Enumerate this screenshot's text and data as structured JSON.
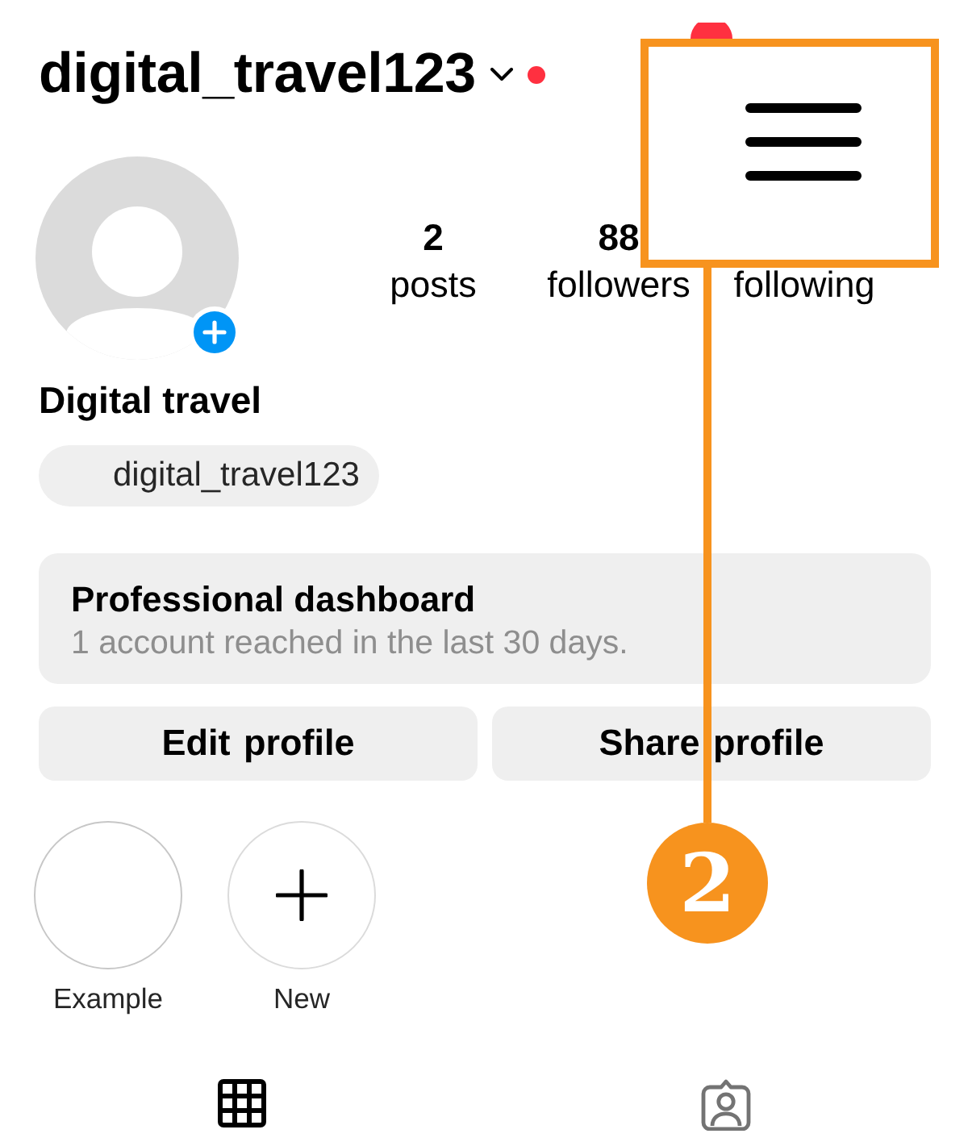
{
  "header": {
    "username": "digital_travel123",
    "has_unread": true,
    "menu_badge": true
  },
  "profile": {
    "stats": [
      {
        "value": "2",
        "label": "posts"
      },
      {
        "value": "88",
        "label": "followers"
      },
      {
        "label": "following"
      }
    ],
    "name": "Digital travel",
    "threads_handle": "digital_travel123"
  },
  "dashboard": {
    "title": "Professional dashboard",
    "subtitle": "1 account reached in the last 30 days."
  },
  "actions": [
    "Edit profile",
    "Share profile"
  ],
  "highlights": [
    {
      "kind": "story",
      "label": "Example"
    },
    {
      "kind": "new",
      "label": "New"
    }
  ],
  "tabs": [
    {
      "kind": "grid",
      "selected": true
    },
    {
      "kind": "tagged",
      "selected": false
    }
  ],
  "annotation": {
    "step": "2"
  }
}
